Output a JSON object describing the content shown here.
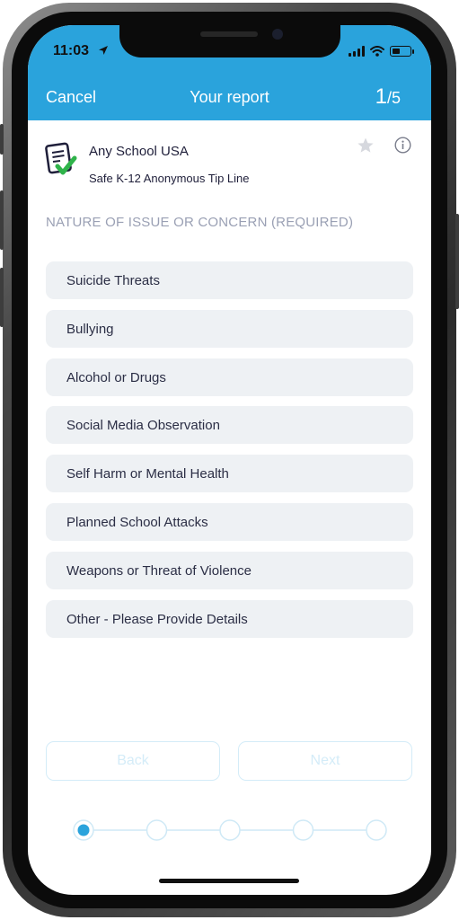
{
  "status_bar": {
    "time": "11:03"
  },
  "header": {
    "cancel_label": "Cancel",
    "title": "Your report",
    "step_current": "1",
    "step_total": "/5",
    "accent_color": "#2aa3dc"
  },
  "school": {
    "name": "Any School USA",
    "subtitle": "Safe K-12 Anonymous Tip Line"
  },
  "section": {
    "label": "NATURE OF ISSUE OR CONCERN (REQUIRED)"
  },
  "options": [
    {
      "label": "Suicide Threats"
    },
    {
      "label": "Bullying"
    },
    {
      "label": "Alcohol or Drugs"
    },
    {
      "label": "Social Media Observation"
    },
    {
      "label": "Self Harm or Mental Health"
    },
    {
      "label": "Planned School Attacks"
    },
    {
      "label": "Weapons or Threat of Violence"
    },
    {
      "label": "Other - Please Provide Details"
    }
  ],
  "footer": {
    "back_label": "Back",
    "next_label": "Next"
  },
  "progress": {
    "current_step": 1,
    "total_steps": 5
  }
}
